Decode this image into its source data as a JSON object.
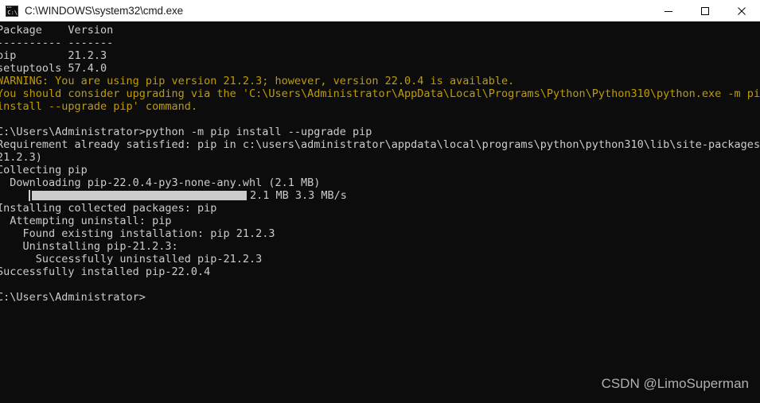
{
  "window": {
    "title": "C:\\WINDOWS\\system32\\cmd.exe",
    "icon": "cmd-console-icon",
    "background_color": "#0c0c0c",
    "titlebar_color": "#ffffff",
    "controls": {
      "minimize_label": "—",
      "maximize_label": "□",
      "close_label": "✕"
    }
  },
  "terminal": {
    "text_color": "#cccccc",
    "warning_color": "#c19c00",
    "lines": [
      {
        "text": "Package    Version",
        "style": "normal"
      },
      {
        "text": "---------- -------",
        "style": "normal"
      },
      {
        "text": "pip        21.2.3",
        "style": "normal"
      },
      {
        "text": "setuptools 57.4.0",
        "style": "normal"
      },
      {
        "text": "WARNING: You are using pip version 21.2.3; however, version 22.0.4 is available.",
        "style": "warn"
      },
      {
        "text": "You should consider upgrading via the 'C:\\Users\\Administrator\\AppData\\Local\\Programs\\Python\\Python310\\python.exe -m pip",
        "style": "warn"
      },
      {
        "text": "install --upgrade pip' command.",
        "style": "warn"
      },
      {
        "text": "",
        "style": "blank"
      },
      {
        "text": "C:\\Users\\Administrator>python -m pip install --upgrade pip",
        "style": "normal"
      },
      {
        "text": "Requirement already satisfied: pip in c:\\users\\administrator\\appdata\\local\\programs\\python\\python310\\lib\\site-packages (",
        "style": "normal"
      },
      {
        "text": "21.2.3)",
        "style": "normal"
      },
      {
        "text": "Collecting pip",
        "style": "normal"
      },
      {
        "text": "  Downloading pip-22.0.4-py3-none-any.whl (2.1 MB)",
        "style": "normal"
      },
      {
        "text": "__PROGRESS__",
        "style": "progress"
      },
      {
        "text": "Installing collected packages: pip",
        "style": "normal"
      },
      {
        "text": "  Attempting uninstall: pip",
        "style": "normal"
      },
      {
        "text": "    Found existing installation: pip 21.2.3",
        "style": "normal"
      },
      {
        "text": "    Uninstalling pip-21.2.3:",
        "style": "normal"
      },
      {
        "text": "      Successfully uninstalled pip-21.2.3",
        "style": "normal"
      },
      {
        "text": "Successfully installed pip-22.0.4",
        "style": "normal"
      },
      {
        "text": "",
        "style": "blank"
      },
      {
        "text": "C:\\Users\\Administrator>",
        "style": "normal"
      }
    ],
    "progress": {
      "fill_percent": 100,
      "fill_color": "#cccccc",
      "downloaded": "2.1 MB",
      "speed": "3.3 MB/s",
      "status_text": "2.1 MB 3.3 MB/s"
    }
  },
  "watermark": {
    "text": "CSDN @LimoSuperman"
  }
}
